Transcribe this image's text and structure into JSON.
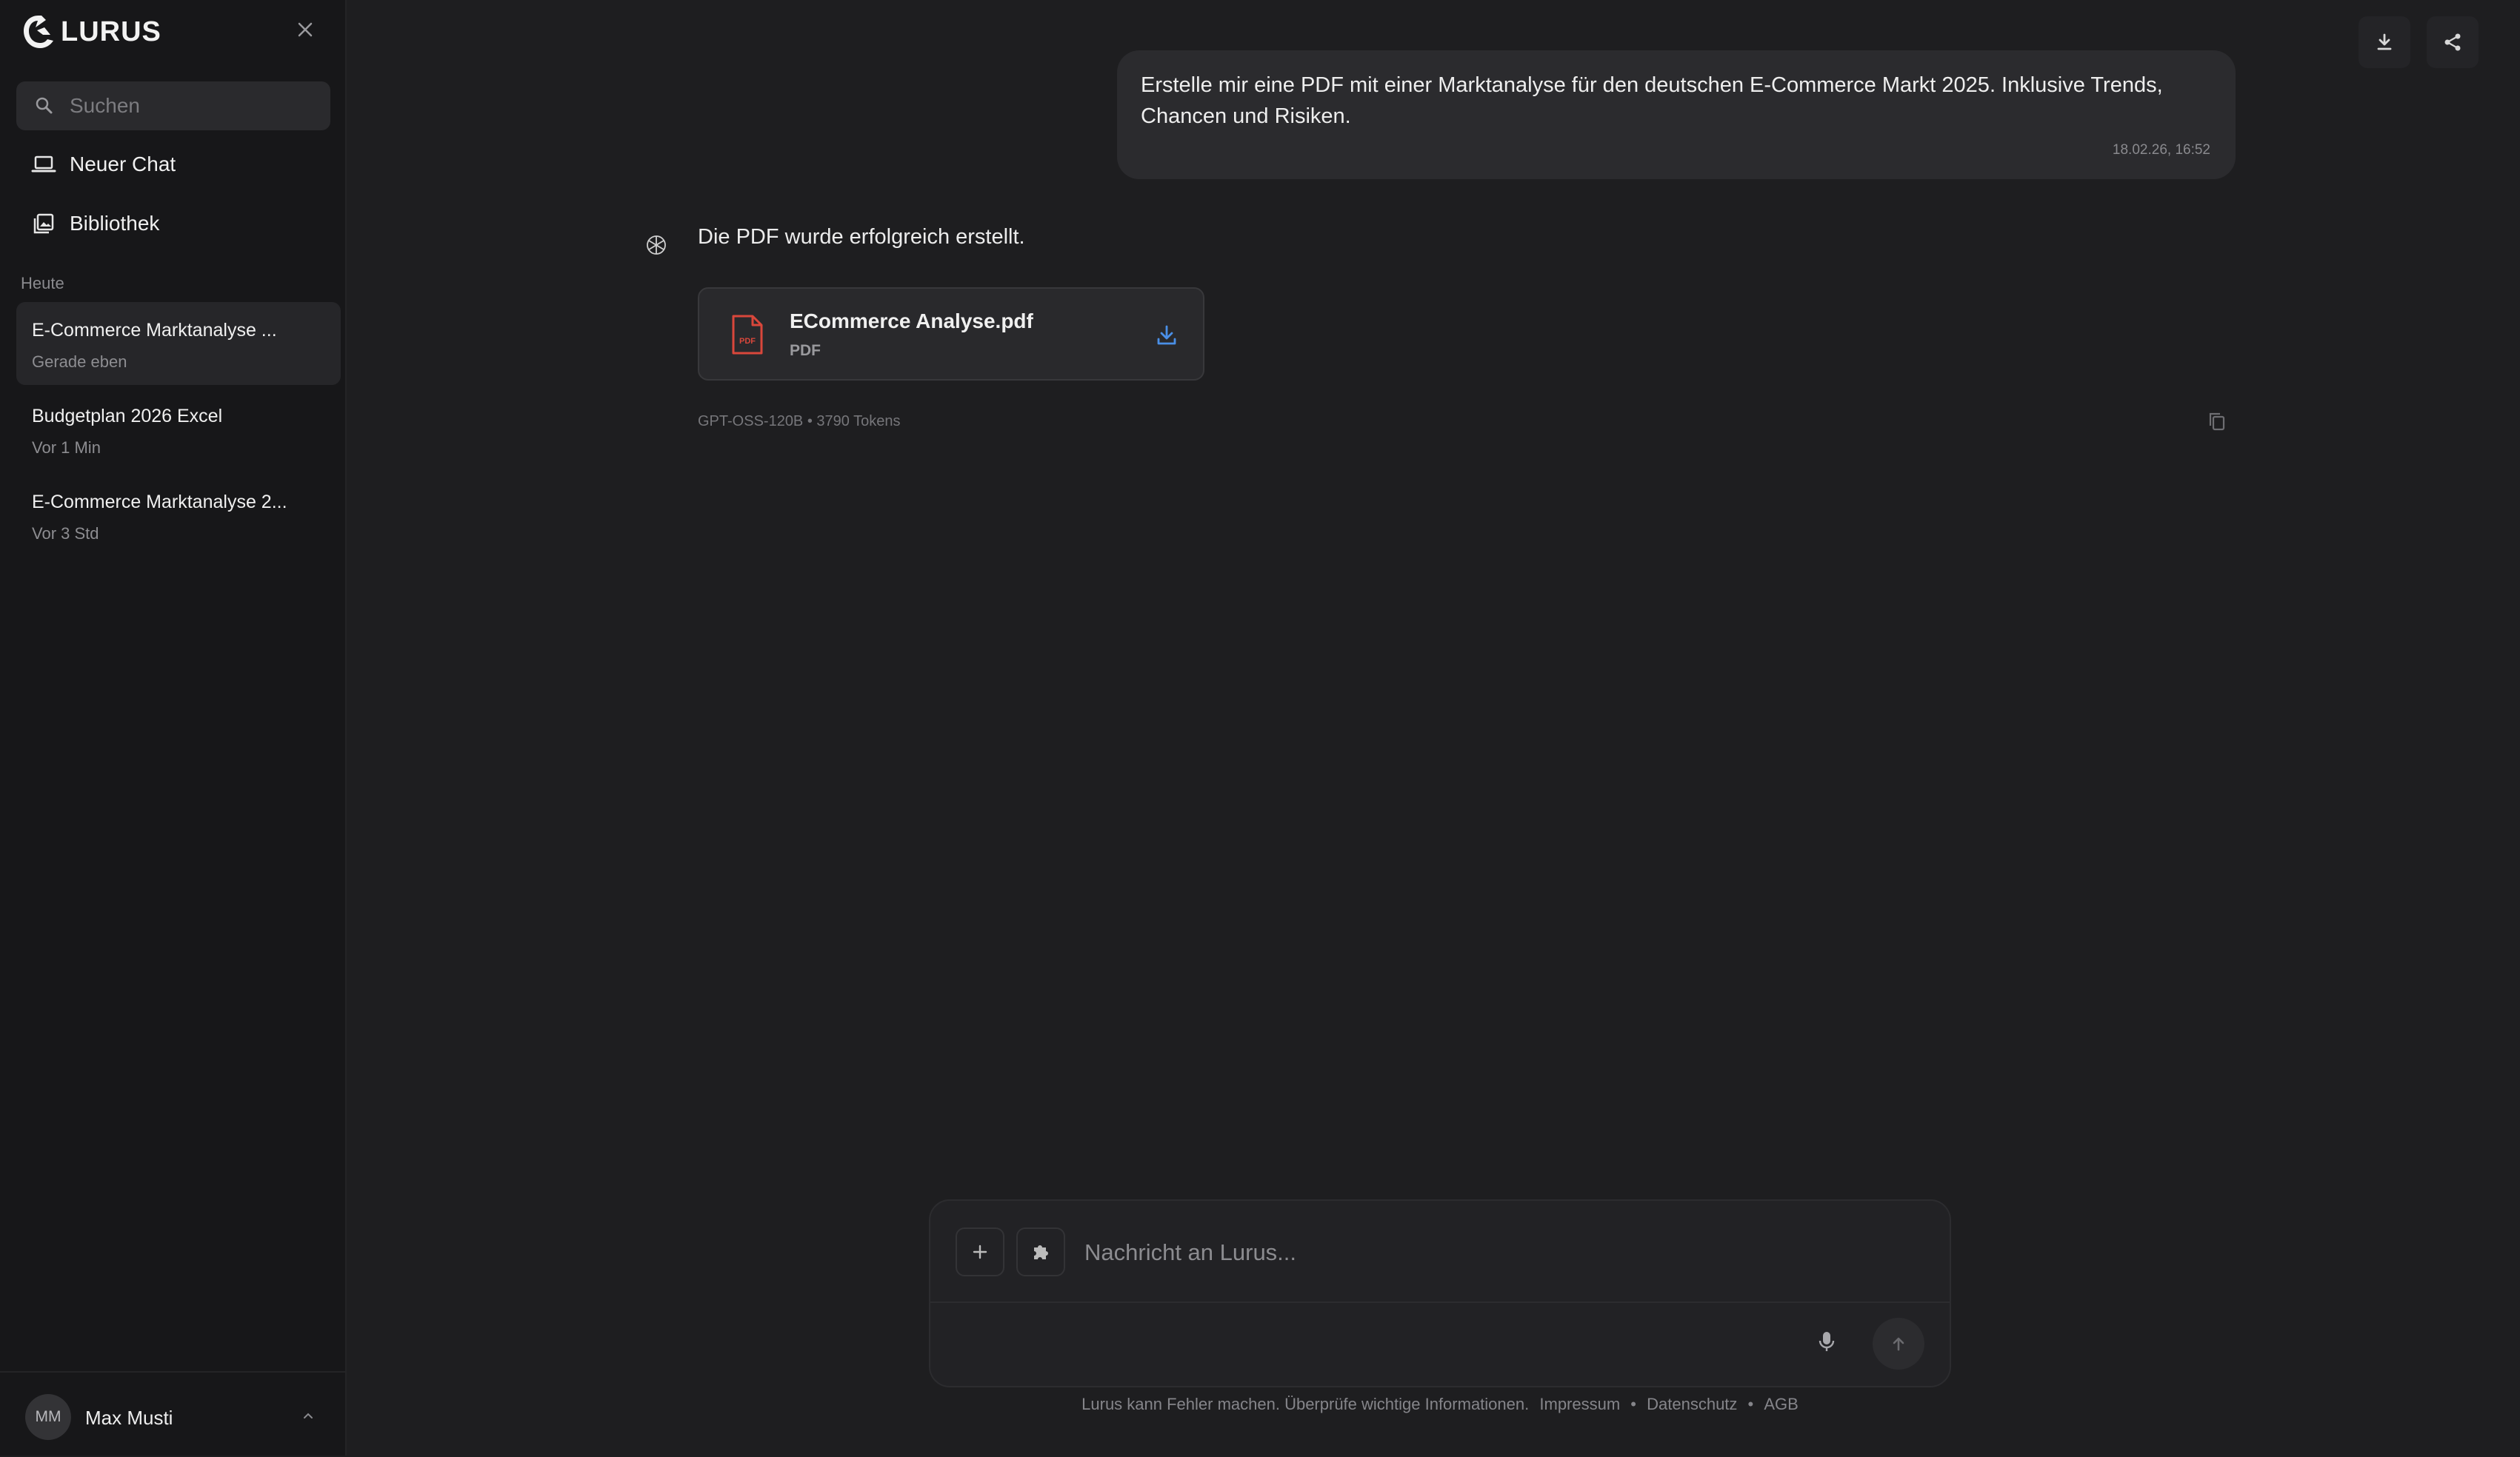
{
  "app": {
    "logo_text": "LURUS"
  },
  "sidebar": {
    "search_placeholder": "Suchen",
    "nav": [
      {
        "label": "Neuer Chat",
        "icon": "laptop-icon"
      },
      {
        "label": "Bibliothek",
        "icon": "library-icon"
      }
    ],
    "section_today": "Heute",
    "chats": [
      {
        "title": "E-Commerce Marktanalyse ...",
        "time": "Gerade eben"
      },
      {
        "title": "Budgetplan 2026 Excel",
        "time": "Vor 1 Min"
      },
      {
        "title": "E-Commerce Marktanalyse 2...",
        "time": "Vor 3 Std"
      }
    ],
    "user": {
      "initials": "MM",
      "name": "Max Musti"
    }
  },
  "conversation": {
    "user_message": {
      "text": "Erstelle mir eine PDF mit einer Marktanalyse für den deutschen E-Commerce Markt 2025. Inklusive Trends, Chancen und Risiken.",
      "timestamp": "18.02.26, 16:52"
    },
    "assistant_message": {
      "text": "Die PDF wurde erfolgreich erstellt.",
      "file": {
        "name": "ECommerce Analyse.pdf",
        "type": "PDF",
        "icon_label": "PDF"
      },
      "meta": "GPT-OSS-120B • 3790 Tokens"
    }
  },
  "composer": {
    "placeholder": "Nachricht an Lurus..."
  },
  "footer": {
    "disclaimer": "Lurus kann Fehler machen. Überprüfe wichtige Informationen.",
    "links": [
      "Impressum",
      "Datenschutz",
      "AGB"
    ],
    "separator": "•"
  },
  "colors": {
    "accent_blue": "#4a8fe7",
    "pdf_red": "#d9473b"
  }
}
